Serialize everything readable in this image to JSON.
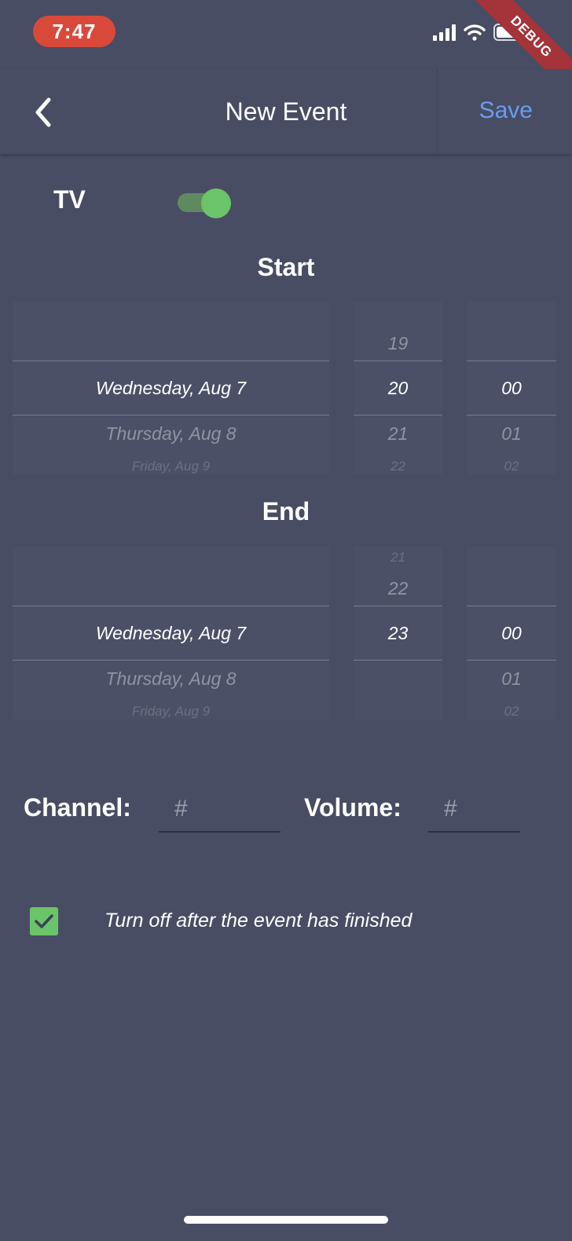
{
  "status_bar": {
    "time": "7:47",
    "icons": [
      "signal-icon",
      "wifi-icon",
      "battery-icon"
    ]
  },
  "debug_banner": "DEBUG",
  "navbar": {
    "back_icon": "chevron-left-icon",
    "title": "New Event",
    "save_label": "Save"
  },
  "tv": {
    "label": "TV",
    "enabled": true
  },
  "start": {
    "title": "Start",
    "dates": {
      "selected": "Wednesday, Aug 7",
      "next": "Thursday, Aug 8",
      "next2": "Friday, Aug 9"
    },
    "hours": {
      "prev": "19",
      "selected": "20",
      "next": "21",
      "next2": "22"
    },
    "minutes": {
      "selected": "00",
      "next": "01",
      "next2": "02"
    }
  },
  "end": {
    "title": "End",
    "dates": {
      "selected": "Wednesday, Aug 7",
      "next": "Thursday, Aug 8",
      "next2": "Friday, Aug 9"
    },
    "hours": {
      "prev2": "21",
      "prev": "22",
      "selected": "23"
    },
    "minutes": {
      "selected": "00",
      "next": "01",
      "next2": "02"
    }
  },
  "channel": {
    "label": "Channel:",
    "placeholder": "#",
    "value": ""
  },
  "volume": {
    "label": "Volume:",
    "placeholder": "#",
    "value": ""
  },
  "turn_off": {
    "checked": true,
    "label": "Turn off after the event has finished"
  },
  "colors": {
    "background": "#484d63",
    "accent_green": "#6bc469",
    "save_blue": "#6a9cf2",
    "time_pill": "#d9493a",
    "debug_banner": "#a4343a"
  }
}
